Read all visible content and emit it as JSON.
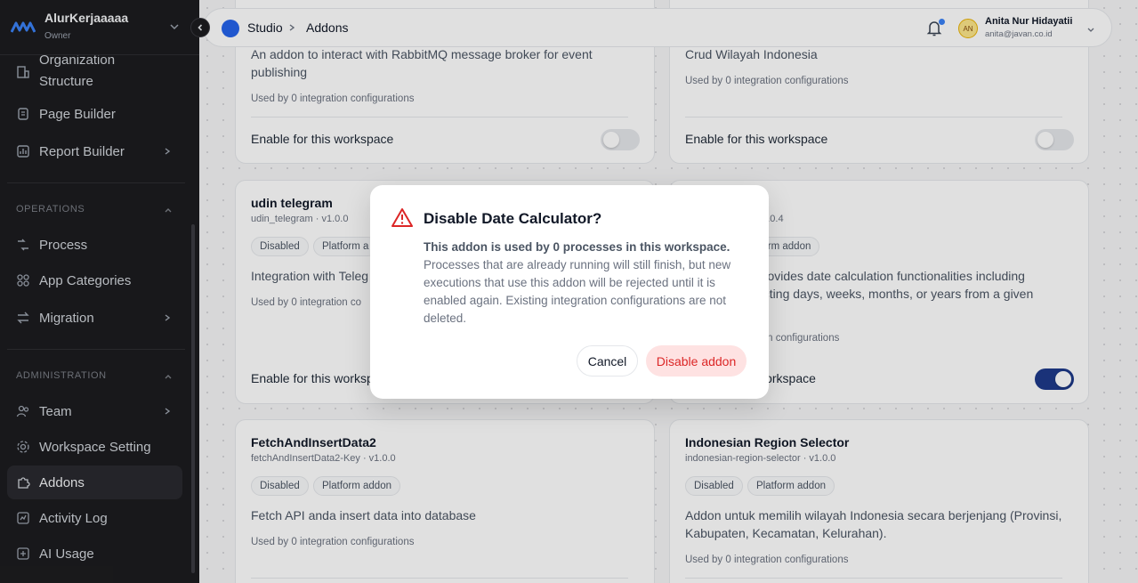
{
  "workspace": {
    "name": "AlurKerjaaaaa",
    "role": "Owner"
  },
  "sidebar": {
    "items_top": [
      {
        "label": "Organization Structure",
        "icon": "building-icon"
      },
      {
        "label": "Page Builder",
        "icon": "page-icon"
      },
      {
        "label": "Report Builder",
        "icon": "chart-icon"
      }
    ],
    "operations_label": "OPERATIONS",
    "operations": [
      {
        "label": "Process",
        "icon": "workflow-icon"
      },
      {
        "label": "App Categories",
        "icon": "grid-icon"
      },
      {
        "label": "Migration",
        "icon": "migration-icon"
      }
    ],
    "administration_label": "ADMINISTRATION",
    "administration": [
      {
        "label": "Team",
        "icon": "team-icon"
      },
      {
        "label": "Workspace Setting",
        "icon": "gear-icon"
      },
      {
        "label": "Addons",
        "icon": "puzzle-icon"
      },
      {
        "label": "Activity Log",
        "icon": "log-icon"
      },
      {
        "label": "AI Usage",
        "icon": "ai-icon"
      }
    ]
  },
  "header": {
    "breadcrumb": [
      "Studio",
      "Addons"
    ],
    "user": {
      "initials": "AN",
      "name": "Anita Nur Hidayatii",
      "email": "anita@javan.co.id"
    }
  },
  "cards": [
    {
      "description": "An addon to interact with RabbitMQ message broker for event publishing",
      "used_by": "Used by 0 integration configurations",
      "enable_label": "Enable for this workspace",
      "enabled": false
    },
    {
      "description": "Crud Wilayah Indonesia",
      "used_by": "Used by 0 integration configurations",
      "enable_label": "Enable for this workspace",
      "enabled": false
    },
    {
      "title": "udin telegram",
      "key": "udin_telegram · v1.0.0",
      "tags": [
        "Disabled",
        "Platform a"
      ],
      "description": "Integration with Teleg",
      "used_by": "Used by 0 integration co",
      "enable_label": "Enable for this worksp",
      "enabled": false
    },
    {
      "key": "94.0.4",
      "tags": [
        "tform addon"
      ],
      "description_lines": [
        "provides date calculation functionalities including",
        "acting days, weeks, months, or years from a given"
      ],
      "used_by": "tion configurations",
      "enable_label": "workspace",
      "enabled": true
    },
    {
      "title": "FetchAndInsertData2",
      "key": "fetchAndInsertData2-Key · v1.0.0",
      "tags": [
        "Disabled",
        "Platform addon"
      ],
      "description": "Fetch API anda insert data into database",
      "used_by": "Used by 0 integration configurations"
    },
    {
      "title": "Indonesian Region Selector",
      "key": "indonesian-region-selector · v1.0.0",
      "tags": [
        "Disabled",
        "Platform addon"
      ],
      "description": "Addon untuk memilih wilayah Indonesia secara berjenjang (Provinsi, Kabupaten, Kecamatan, Kelurahan).",
      "used_by": "Used by 0 integration configurations"
    }
  ],
  "modal": {
    "title": "Disable Date Calculator?",
    "body_bold": "This addon is used by 0 processes in this workspace.",
    "body_rest": "Processes that are already running will still finish, but new executions that use this addon will be rejected until it is enabled again. Existing integration configurations are not deleted.",
    "cancel_label": "Cancel",
    "confirm_label": "Disable addon"
  },
  "colors": {
    "accent": "#2563eb",
    "danger": "#dc2626",
    "danger_bg": "#fee2e2",
    "toggle_on": "#1e3a8a",
    "sidebar_bg": "#1c1c1f"
  }
}
